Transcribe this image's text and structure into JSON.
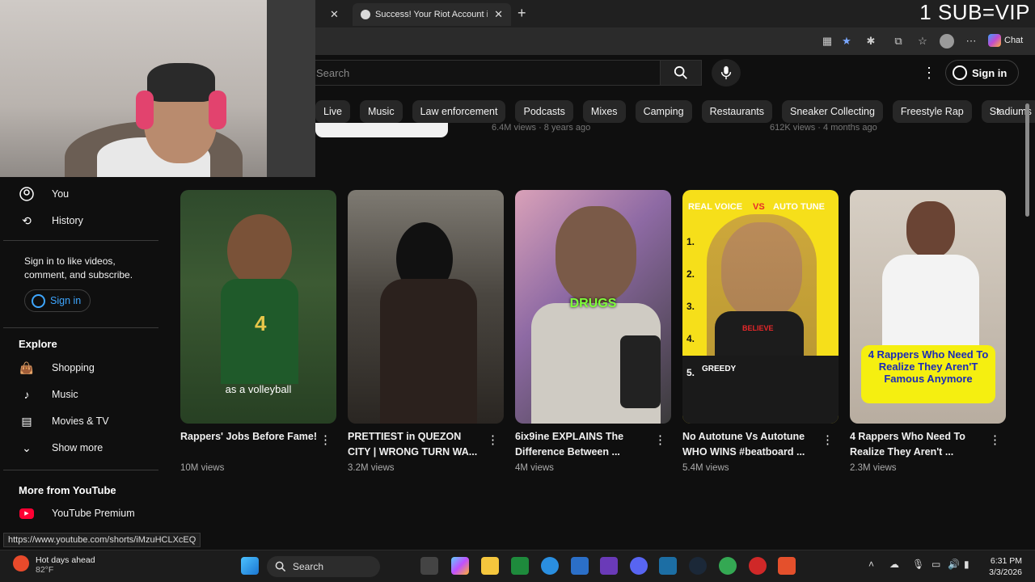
{
  "browser": {
    "tab_active_title": "Success! Your Riot Account is now",
    "overlay_text": "1 SUB=VIP",
    "chat_label": "Chat"
  },
  "youtube": {
    "search_placeholder": "Search",
    "signin_label": "Sign in",
    "chips": [
      "Live",
      "Music",
      "Law enforcement",
      "Podcasts",
      "Mixes",
      "Camping",
      "Restaurants",
      "Sneaker Collecting",
      "Freestyle Rap",
      "Stadiums"
    ],
    "prev_row": [
      "6.4M views · 8 years ago",
      "612K views · 4 months ago"
    ]
  },
  "sidebar": {
    "you": "You",
    "history": "History",
    "signin_prompt": "Sign in to like videos, comment, and subscribe.",
    "signin_button": "Sign in",
    "explore_heading": "Explore",
    "explore_items": [
      "Shopping",
      "Music",
      "Movies & TV",
      "Show more"
    ],
    "more_heading": "More from YouTube",
    "more_items": [
      "YouTube Premium"
    ]
  },
  "shorts": [
    {
      "title": "Rappers' Jobs Before Fame!",
      "views": "10M views",
      "caption": "as a volleyball"
    },
    {
      "title": "PRETTIEST in QUEZON CITY | WRONG TURN WA...",
      "views": "3.2M views",
      "caption": ""
    },
    {
      "title": "6ix9ine EXPLAINS The Difference Between ...",
      "views": "4M views",
      "caption": "DRUGS"
    },
    {
      "title": "No Autotune Vs Autotune WHO WINS #beatboard ...",
      "views": "5.4M views",
      "caption": "REAL VOICE VS AUTO TUNE",
      "caption_real": "REAL VOICE",
      "caption_vs": "VS",
      "caption_auto": "AUTO TUNE",
      "list": [
        "1.",
        "2.",
        "3.",
        "4.",
        "5."
      ],
      "greedy": "GREEDY",
      "believe": "BELIEVE"
    },
    {
      "title": "4 Rappers Who Need To Realize They Aren't ...",
      "views": "2.3M views",
      "caption": "4 Rappers Who Need To Realize They Aren'T Famous Anymore"
    }
  ],
  "status_url": "https://www.youtube.com/shorts/iMzuHCLXcEQ",
  "taskbar": {
    "weather_title": "Hot days ahead",
    "weather_temp": "82°F",
    "search_label": "Search",
    "time": "6:31 PM",
    "date": "3/3/2026"
  }
}
